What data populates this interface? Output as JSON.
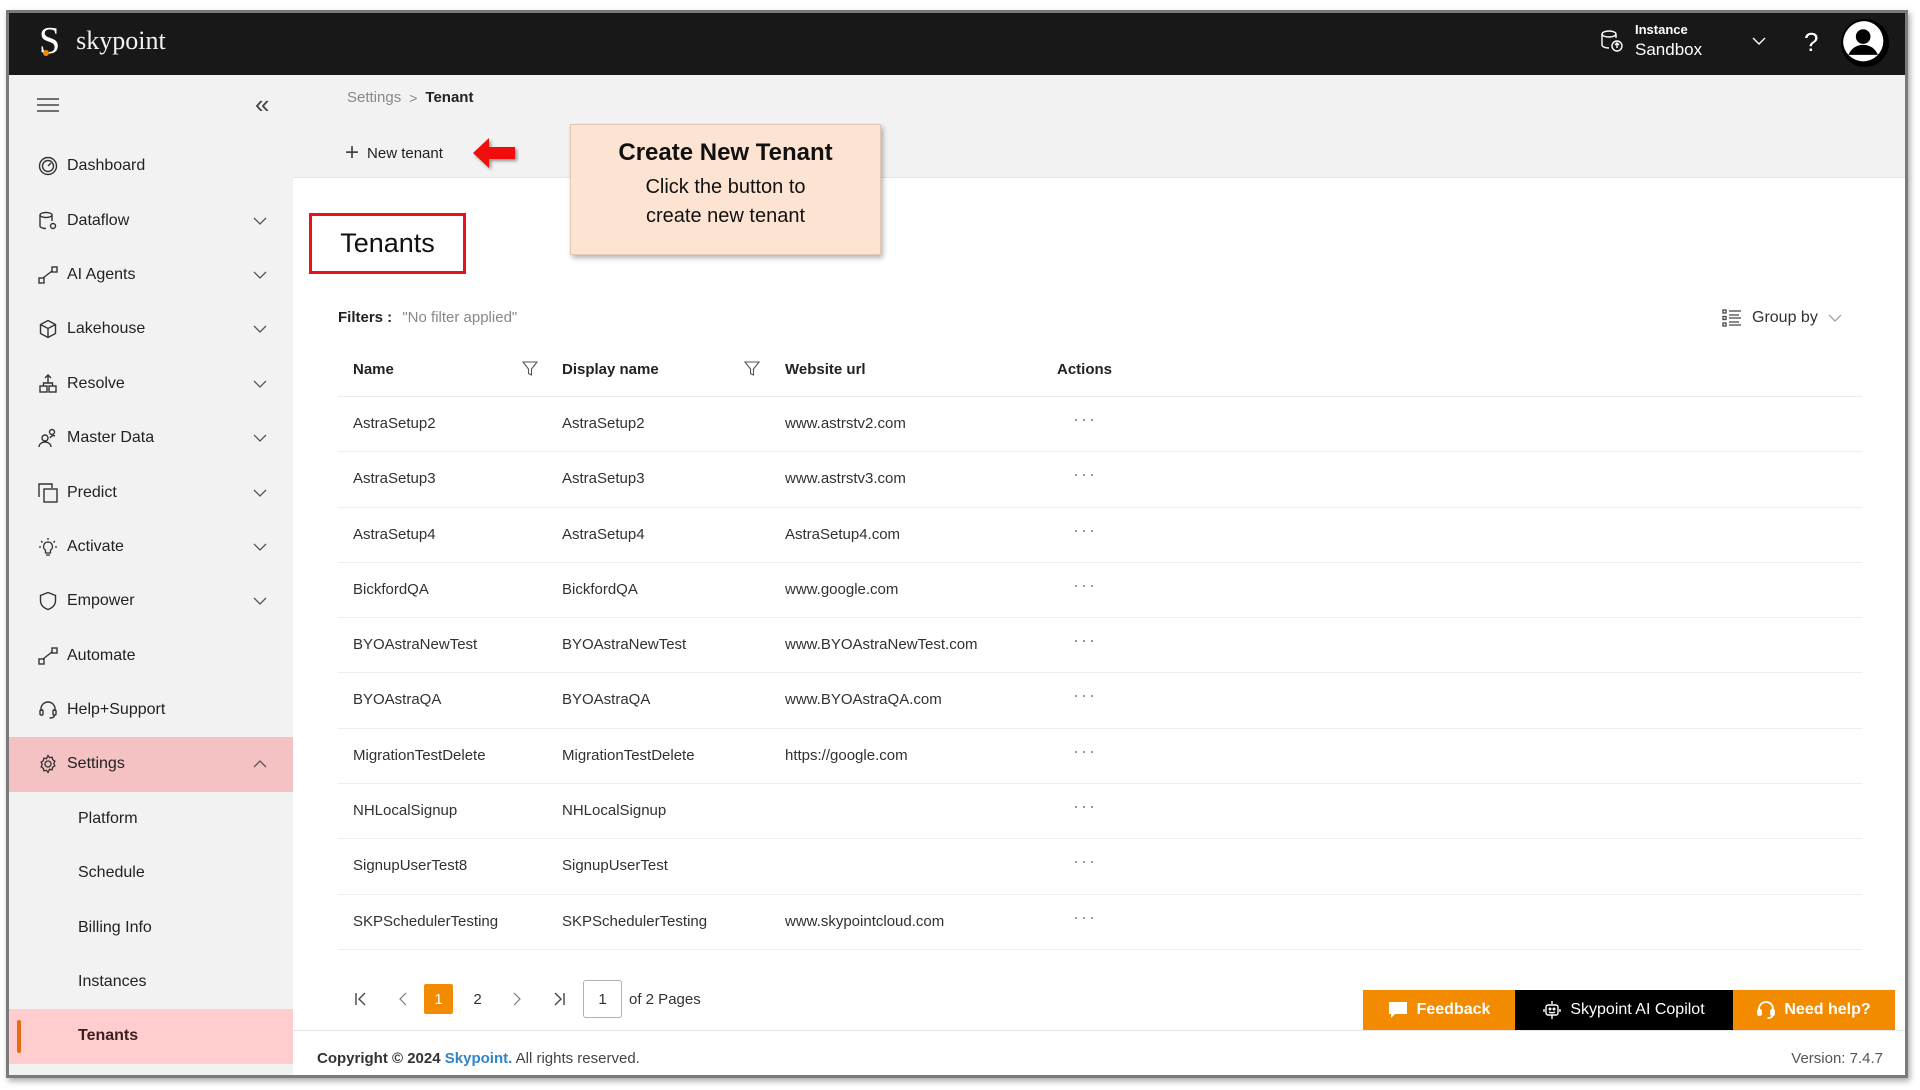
{
  "app": {
    "brand": "skypoint"
  },
  "topbar": {
    "instance_label": "Instance",
    "instance_value": "Sandbox",
    "help_label": "?"
  },
  "sidebar": {
    "items": [
      {
        "label": "Dashboard",
        "icon": "dashboard-gauge-icon",
        "expandable": false
      },
      {
        "label": "Dataflow",
        "icon": "dataflow-database-icon",
        "expandable": true
      },
      {
        "label": "AI Agents",
        "icon": "ai-agents-flow-icon",
        "expandable": true
      },
      {
        "label": "Lakehouse",
        "icon": "lakehouse-cube-icon",
        "expandable": true
      },
      {
        "label": "Resolve",
        "icon": "resolve-hierarchy-icon",
        "expandable": true
      },
      {
        "label": "Master Data",
        "icon": "master-data-people-icon",
        "expandable": true
      },
      {
        "label": "Predict",
        "icon": "predict-squares-icon",
        "expandable": true
      },
      {
        "label": "Activate",
        "icon": "activate-lightbulb-icon",
        "expandable": true
      },
      {
        "label": "Empower",
        "icon": "empower-shield-icon",
        "expandable": true
      },
      {
        "label": "Automate",
        "icon": "automate-flow-icon",
        "expandable": false
      },
      {
        "label": "Help+Support",
        "icon": "headset-icon",
        "expandable": false
      },
      {
        "label": "Settings",
        "icon": "gear-icon",
        "expandable": true,
        "expanded": true,
        "active": true
      }
    ],
    "settings_sub": [
      {
        "label": "Platform"
      },
      {
        "label": "Schedule"
      },
      {
        "label": "Billing Info"
      },
      {
        "label": "Instances"
      },
      {
        "label": "Tenants",
        "selected": true
      }
    ]
  },
  "breadcrumb": {
    "parent": "Settings",
    "separator": ">",
    "current": "Tenant"
  },
  "toolbar": {
    "new_tenant_label": "New tenant"
  },
  "callout": {
    "title": "Create New Tenant",
    "line1": "Click the button to",
    "line2": "create new tenant"
  },
  "page": {
    "title": "Tenants"
  },
  "filters": {
    "label": "Filters :",
    "value": "\"No filter applied\""
  },
  "groupby": {
    "label": "Group by"
  },
  "table": {
    "columns": [
      "Name",
      "Display name",
      "Website url",
      "Actions"
    ],
    "rows": [
      {
        "name": "AstraSetup2",
        "display": "AstraSetup2",
        "url": "www.astrstv2.com",
        "actions": "···"
      },
      {
        "name": "AstraSetup3",
        "display": "AstraSetup3",
        "url": "www.astrstv3.com",
        "actions": "···"
      },
      {
        "name": "AstraSetup4",
        "display": "AstraSetup4",
        "url": "AstraSetup4.com",
        "actions": "···"
      },
      {
        "name": "BickfordQA",
        "display": "BickfordQA",
        "url": "www.google.com",
        "actions": "···"
      },
      {
        "name": "BYOAstraNewTest",
        "display": "BYOAstraNewTest",
        "url": "www.BYOAstraNewTest.com",
        "actions": "···"
      },
      {
        "name": "BYOAstraQA",
        "display": "BYOAstraQA",
        "url": "www.BYOAstraQA.com",
        "actions": "···"
      },
      {
        "name": "MigrationTestDelete",
        "display": "MigrationTestDelete",
        "url": "https://google.com",
        "actions": "···"
      },
      {
        "name": "NHLocalSignup",
        "display": "NHLocalSignup",
        "url": "",
        "actions": "···"
      },
      {
        "name": "SignupUserTest8",
        "display": "SignupUserTest",
        "url": "",
        "actions": "···"
      },
      {
        "name": "SKPSchedulerTesting",
        "display": "SKPSchedulerTesting",
        "url": "www.skypointcloud.com",
        "actions": "···"
      }
    ]
  },
  "pagination": {
    "pages": [
      "1",
      "2"
    ],
    "current_page": "1",
    "page_input": "1",
    "of_label": "of 2 Pages"
  },
  "footer": {
    "copyright_prefix": "Copyright © 2024",
    "brand": "Skypoint.",
    "suffix": "All rights reserved.",
    "version": "Version: 7.4.7",
    "buttons": {
      "feedback": "Feedback",
      "copilot": "Skypoint AI Copilot",
      "need_help": "Need help?"
    }
  },
  "colors": {
    "accent_orange": "#f28b00",
    "topbar_bg": "#181818",
    "sidebar_active": "#f4c2c2",
    "annotation_red": "#e8121b",
    "callout_bg": "#fde4d2",
    "brand_link": "#2f85c7"
  }
}
